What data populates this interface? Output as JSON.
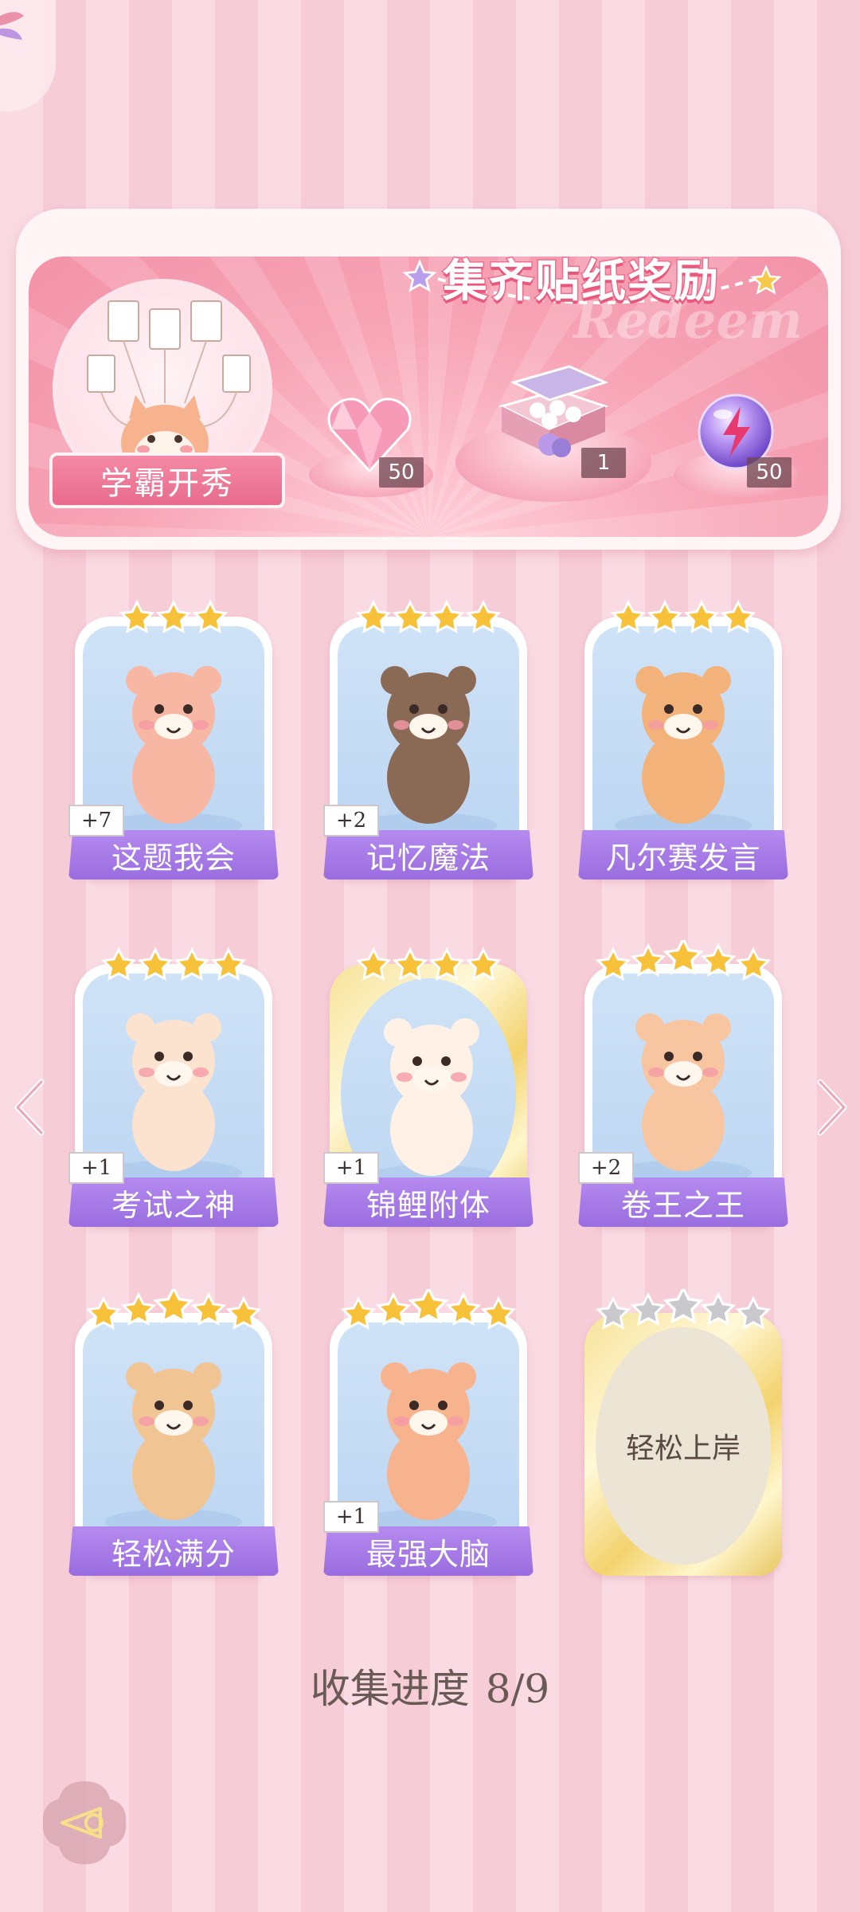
{
  "banner": {
    "title": "集齐贴纸奖励",
    "watermark": "Redeem",
    "medallion_label": "学霸开秀",
    "rewards": [
      {
        "icon": "pink-heart-gem-icon",
        "count": "50"
      },
      {
        "icon": "gift-box-icon",
        "count": "1"
      },
      {
        "icon": "purple-energy-orb-icon",
        "count": "50"
      }
    ]
  },
  "cards": [
    {
      "label": "这题我会",
      "badge": "+7",
      "stars": 3,
      "collected": true,
      "frame": "white"
    },
    {
      "label": "记忆魔法",
      "badge": "+2",
      "stars": 4,
      "collected": true,
      "frame": "white"
    },
    {
      "label": "凡尔赛发言",
      "badge": "",
      "stars": 4,
      "collected": true,
      "frame": "white"
    },
    {
      "label": "考试之神",
      "badge": "+1",
      "stars": 4,
      "collected": true,
      "frame": "white"
    },
    {
      "label": "锦鲤附体",
      "badge": "+1",
      "stars": 4,
      "collected": true,
      "frame": "gold"
    },
    {
      "label": "卷王之王",
      "badge": "+2",
      "stars": 5,
      "collected": true,
      "frame": "white"
    },
    {
      "label": "轻松满分",
      "badge": "",
      "stars": 5,
      "collected": true,
      "frame": "white"
    },
    {
      "label": "最强大脑",
      "badge": "+1",
      "stars": 5,
      "collected": true,
      "frame": "white"
    },
    {
      "label": "轻松上岸",
      "badge": "",
      "stars": 5,
      "collected": false,
      "frame": "gold"
    }
  ],
  "progress": {
    "label": "收集进度",
    "count": "8/9"
  },
  "colors": {
    "label_purple": "#a57be6",
    "banner_pink": "#f392a8",
    "star_gold": "#f7c23a",
    "star_gray": "#c9c9cd"
  }
}
